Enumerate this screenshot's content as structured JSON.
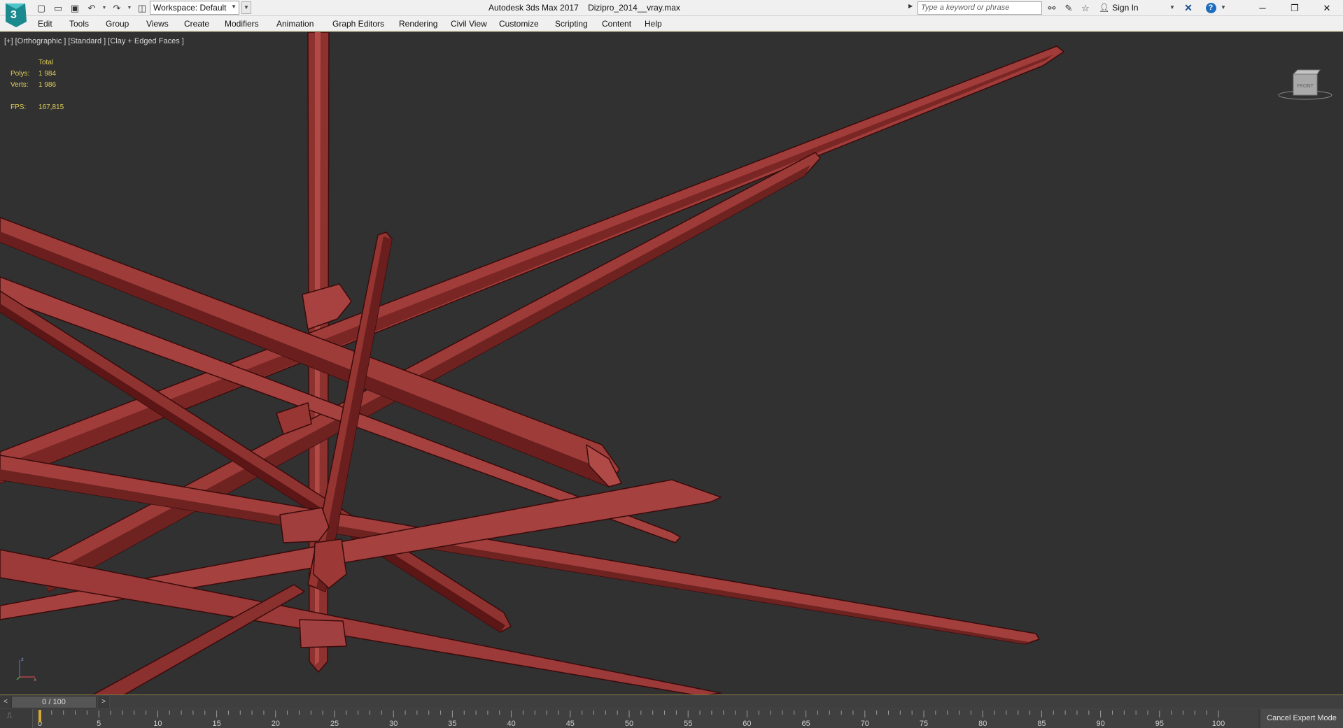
{
  "titlebar": {
    "app_name": "Autodesk 3ds Max 2017",
    "file_name": "Dizipro_2014__vray.max",
    "workspace": "Workspace: Default",
    "search_placeholder": "Type a keyword or phrase",
    "sign_in": "Sign In"
  },
  "menu": [
    "Edit",
    "Tools",
    "Group",
    "Views",
    "Create",
    "Modifiers",
    "Animation",
    "Graph Editors",
    "Rendering",
    "Civil View",
    "Customize",
    "Scripting",
    "Content",
    "Help"
  ],
  "viewport": {
    "label": "[+] [Orthographic ] [Standard ] [Clay + Edged Faces ]",
    "viewcube_label": "FRONT",
    "stats": {
      "header": "Total",
      "polys_label": "Polys:",
      "polys_value": "1 984",
      "verts_label": "Verts:",
      "verts_value": "1 986",
      "fps_label": "FPS:",
      "fps_value": "167,815"
    },
    "colors": {
      "background": "#313131",
      "object": "#9b3a38",
      "object_dark": "#5c1616",
      "stats_text": "#e0cf5a"
    }
  },
  "timeslider": {
    "value": "0 / 100",
    "prev": "<",
    "next": ">"
  },
  "trackbar": {
    "ticks": [
      "0",
      "5",
      "10",
      "15",
      "20",
      "25",
      "30",
      "35",
      "40",
      "45",
      "50",
      "55",
      "60",
      "65",
      "70",
      "75",
      "80",
      "85",
      "90",
      "95",
      "100"
    ],
    "cancel_expert": "Cancel Expert Mode"
  }
}
